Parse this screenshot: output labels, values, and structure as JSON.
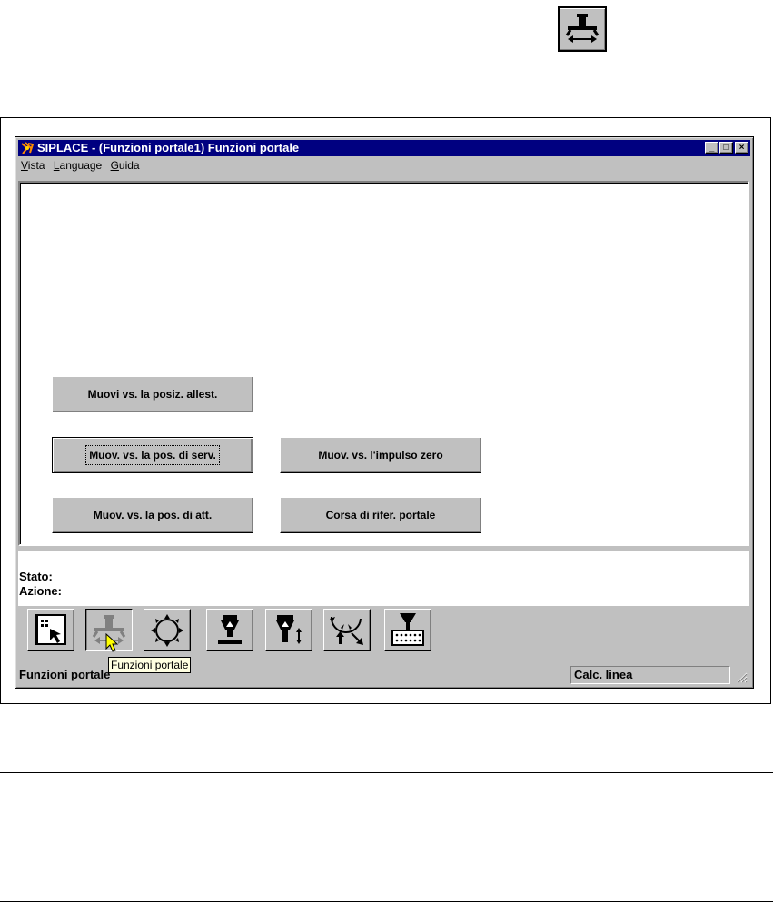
{
  "window": {
    "title": "SIPLACE - (Funzioni portale1) Funzioni portale",
    "minimize_glyph": "_",
    "maximize_glyph": "□",
    "close_glyph": "×"
  },
  "menu": {
    "items": [
      {
        "underline": "V",
        "rest": "ista"
      },
      {
        "underline": "L",
        "rest": "anguage"
      },
      {
        "underline": "G",
        "rest": "uida"
      }
    ]
  },
  "buttons": {
    "setup_pos": "Muovi vs. la posiz. allest.",
    "service_pos": "Muov. vs. la pos. di serv.",
    "zero_pulse": "Muov. vs. l'impulso zero",
    "wait_pos": "Muov. vs. la pos. di att.",
    "reference_run": "Corsa di rifer. portale"
  },
  "status": {
    "stato_label": "Stato:",
    "azione_label": "Azione:"
  },
  "toolbar": {
    "icons": [
      "grid-select-icon",
      "gantry-functions-icon",
      "star-wheel-icon",
      "nozzle-icon",
      "nozzle-height-icon",
      "revolver-head-icon",
      "feeder-table-icon"
    ],
    "pressed_index": 1
  },
  "statusbar": {
    "left_text": "Funzioni portale",
    "right_text": "Calc. linea"
  },
  "tooltip": {
    "text": "Funzioni portale"
  },
  "colors": {
    "title_bar": "#000080",
    "face": "#c0c0c0",
    "tooltip_bg": "#ffffe1"
  }
}
